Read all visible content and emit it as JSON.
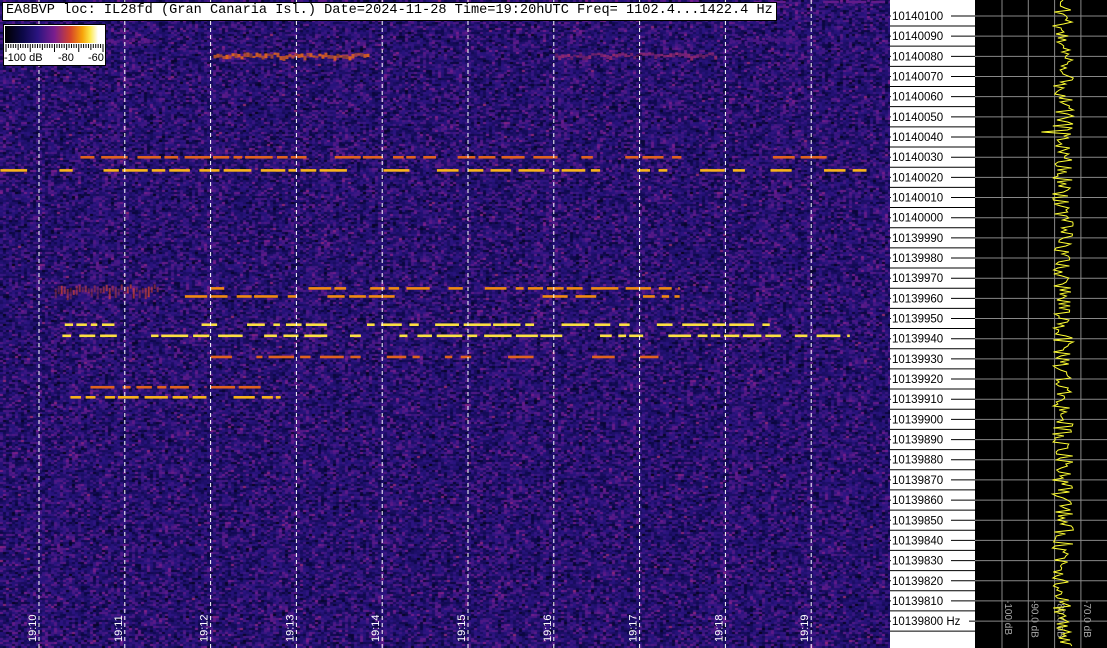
{
  "header": {
    "text": "EA8BVP loc: IL28fd (Gran Canaria Isl.) Date=2024-11-28 Time=19:20hUTC Freq= 1102.4...1422.4 Hz"
  },
  "colorbar": {
    "labels": [
      "-100 dB",
      "-80",
      "-60"
    ],
    "range_db": [
      -100,
      -60
    ]
  },
  "chart_data": {
    "type": "heatmap",
    "subtype": "spectrogram waterfall",
    "x_axis": {
      "kind": "time",
      "range": [
        "19:09:33",
        "19:19:55"
      ],
      "ticks": [
        "19:10",
        "19:11",
        "19:12",
        "19:13",
        "19:14",
        "19:15",
        "19:16",
        "19:17",
        "19:18",
        "19:19"
      ],
      "gridlines": "dashed white"
    },
    "y_axis": {
      "unit": "Hz",
      "range": [
        10139787,
        10140108
      ],
      "ticks": [
        10140100,
        10140090,
        10140080,
        10140070,
        10140060,
        10140050,
        10140040,
        10140030,
        10140020,
        10140010,
        10140000,
        10139990,
        10139980,
        10139970,
        10139960,
        10139950,
        10139940,
        10139930,
        10139920,
        10139910,
        10139900,
        10139890,
        10139880,
        10139870,
        10139860,
        10139850,
        10139840,
        10139830,
        10139820,
        10139810,
        10139800
      ],
      "last_tick_suffix": "Hz"
    },
    "color_scale_db": [
      -100,
      -60
    ],
    "noise_floor_db": -88,
    "signals": [
      {
        "start": "19:09:33",
        "end": "19:19:55",
        "freq": 10140023.5,
        "level_db": -68,
        "style": "dashed"
      },
      {
        "start": "19:10:29",
        "end": "19:19:34",
        "freq": 10140030,
        "level_db": -72,
        "style": "dashed"
      },
      {
        "start": "19:12:02",
        "end": "19:13:51",
        "freq": 10140080.5,
        "level_db": -72,
        "style": "blob"
      },
      {
        "start": "19:16:01",
        "end": "19:17:53",
        "freq": 10140080.5,
        "level_db": -78,
        "style": "blob"
      },
      {
        "start": "19:10:46",
        "end": "19:11:18",
        "freq": 10140088,
        "level_db": -82,
        "style": "blob"
      },
      {
        "start": "19:18:03",
        "end": "19:18:59",
        "freq": 10140088,
        "level_db": -84,
        "style": "blob"
      },
      {
        "start": "19:10:11",
        "end": "19:11:24",
        "freq": 10139964,
        "level_db": -74,
        "style": "smear"
      },
      {
        "start": "19:12:00",
        "end": "19:17:28",
        "freq": 10139965,
        "level_db": -70,
        "style": "dashed"
      },
      {
        "start": "19:11:42",
        "end": "19:17:28",
        "freq": 10139961,
        "level_db": -70,
        "style": "dashed"
      },
      {
        "start": "19:10:18",
        "end": "19:18:31",
        "freq": 10139947,
        "level_db": -66,
        "style": "dashed"
      },
      {
        "start": "19:10:01",
        "end": "19:19:27",
        "freq": 10139941.5,
        "level_db": -66,
        "style": "dashed"
      },
      {
        "start": "19:12:00",
        "end": "19:17:21",
        "freq": 10139931,
        "level_db": -72,
        "style": "dashed"
      },
      {
        "start": "19:10:36",
        "end": "19:12:35",
        "freq": 10139916,
        "level_db": -72,
        "style": "dashed"
      },
      {
        "start": "19:10:22",
        "end": "19:12:49",
        "freq": 10139911,
        "level_db": -68,
        "style": "dashed"
      },
      {
        "start": "19:18:03",
        "end": "19:19:55",
        "freq": 10140107,
        "level_db": -82,
        "style": "dashed"
      }
    ],
    "spectrum_panel": {
      "db_labels": [
        "-100 dB",
        "-90.0 dB",
        "-80.0 dB",
        "-70.0 dB"
      ],
      "db_ticks": [
        -100,
        -90,
        -80,
        -70
      ],
      "trace_mean_db": -78,
      "trace_color": "#ffff33"
    }
  },
  "colors": {
    "trace": "#ffff33",
    "grid": "#ffffff",
    "signal": "#ffcc33"
  }
}
